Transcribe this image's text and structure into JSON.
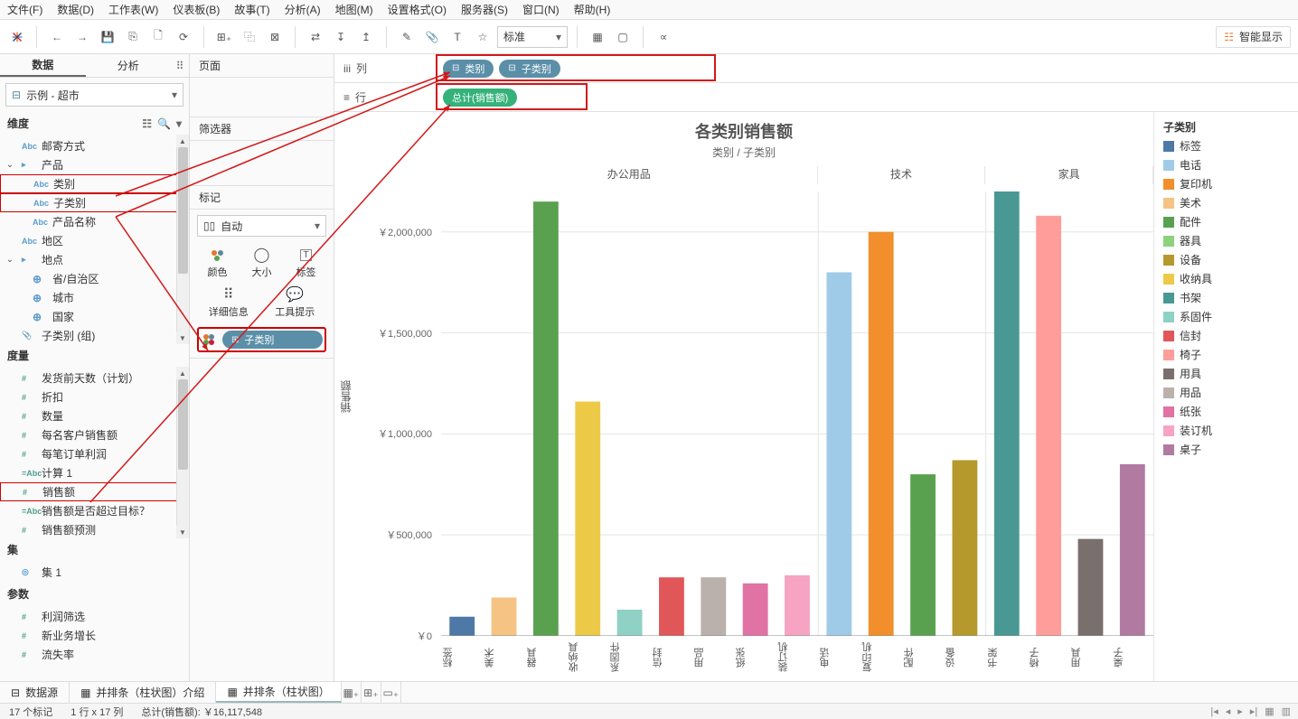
{
  "menu": [
    "文件(F)",
    "数据(D)",
    "工作表(W)",
    "仪表板(B)",
    "故事(T)",
    "分析(A)",
    "地图(M)",
    "设置格式(O)",
    "服务器(S)",
    "窗口(N)",
    "帮助(H)"
  ],
  "toolbar": {
    "style_label": "标准",
    "show_me": "智能显示"
  },
  "left": {
    "tabs": [
      "数据",
      "分析"
    ],
    "datasource": "示例 - 超市",
    "dimensions_title": "维度",
    "measures_title": "度量",
    "sets_title": "集",
    "params_title": "参数",
    "dims": [
      {
        "icon": "Abc",
        "label": "邮寄方式"
      },
      {
        "icon": "folder",
        "label": "产品",
        "expand": true
      },
      {
        "icon": "Abc",
        "label": "类别",
        "indent": 1,
        "hl": true
      },
      {
        "icon": "Abc",
        "label": "子类别",
        "indent": 1,
        "hl": true
      },
      {
        "icon": "Abc",
        "label": "产品名称",
        "indent": 1
      },
      {
        "icon": "Abc",
        "label": "地区"
      },
      {
        "icon": "folder",
        "label": "地点",
        "expand": true
      },
      {
        "icon": "globe",
        "label": "省/自治区",
        "indent": 1
      },
      {
        "icon": "globe",
        "label": "城市",
        "indent": 1
      },
      {
        "icon": "globe",
        "label": "国家",
        "indent": 1
      },
      {
        "icon": "clip",
        "label": "子类别 (组)"
      }
    ],
    "meas": [
      {
        "icon": "#",
        "label": "发货前天数（计划）"
      },
      {
        "icon": "#",
        "label": "折扣"
      },
      {
        "icon": "#",
        "label": "数量"
      },
      {
        "icon": "#",
        "label": "每名客户销售额"
      },
      {
        "icon": "#",
        "label": "每笔订单利润"
      },
      {
        "icon": "=Abc",
        "label": "计算 1"
      },
      {
        "icon": "#",
        "label": "销售额",
        "hl": true
      },
      {
        "icon": "=Abc",
        "label": "销售额是否超过目标？"
      },
      {
        "icon": "#",
        "label": "销售额预测"
      }
    ],
    "sets": [
      {
        "icon": "set",
        "label": "集 1"
      }
    ],
    "params": [
      {
        "icon": "#",
        "label": "利润筛选"
      },
      {
        "icon": "#",
        "label": "新业务增长"
      },
      {
        "icon": "#",
        "label": "流失率"
      }
    ]
  },
  "mid": {
    "pages": "页面",
    "filters": "筛选器",
    "marks": "标记",
    "mark_type": "自动",
    "cells": [
      "颜色",
      "大小",
      "标签",
      "详细信息",
      "工具提示"
    ],
    "color_pill": "子类别"
  },
  "shelves": {
    "columns": "列",
    "rows": "行",
    "col_pills": [
      "类别",
      "子类别"
    ],
    "row_pills": [
      "总计(销售额)"
    ]
  },
  "chart_data": {
    "type": "bar",
    "title": "各类别销售额",
    "subtitle": "类别 / 子类别",
    "ylabel": "销售额",
    "ylim": [
      0,
      2200000
    ],
    "y_ticks": [
      0,
      500000,
      1000000,
      1500000,
      2000000
    ],
    "y_tick_labels": [
      "￥0",
      "￥500,000",
      "￥1,000,000",
      "￥1,500,000",
      "￥2,000,000"
    ],
    "groups": [
      {
        "name": "办公用品",
        "items": [
          {
            "name": "标签",
            "value": 95000,
            "color": "#4e79a7"
          },
          {
            "name": "美术",
            "value": 190000,
            "color": "#f5c383"
          },
          {
            "name": "器具",
            "value": 2150000,
            "color": "#59a14f"
          },
          {
            "name": "收纳具",
            "value": 1160000,
            "color": "#edc948"
          },
          {
            "name": "系固件",
            "value": 130000,
            "color": "#8fd1c5"
          },
          {
            "name": "信封",
            "value": 290000,
            "color": "#e15759"
          },
          {
            "name": "用品",
            "value": 290000,
            "color": "#bab0ac"
          },
          {
            "name": "纸张",
            "value": 260000,
            "color": "#e072a4"
          },
          {
            "name": "装订机",
            "value": 300000,
            "color": "#f6a4c1"
          }
        ]
      },
      {
        "name": "技术",
        "items": [
          {
            "name": "电话",
            "value": 1800000,
            "color": "#a0cbe8"
          },
          {
            "name": "复印机",
            "value": 2000000,
            "color": "#f28e2b"
          },
          {
            "name": "配件",
            "value": 800000,
            "color": "#59a14f"
          },
          {
            "name": "设备",
            "value": 870000,
            "color": "#b6992d"
          }
        ]
      },
      {
        "name": "家具",
        "items": [
          {
            "name": "书架",
            "value": 2250000,
            "color": "#499894"
          },
          {
            "name": "椅子",
            "value": 2080000,
            "color": "#ff9d9a"
          },
          {
            "name": "用具",
            "value": 480000,
            "color": "#79706e"
          },
          {
            "name": "桌子",
            "value": 850000,
            "color": "#b07aa1"
          }
        ]
      }
    ],
    "legend_title": "子类别",
    "legend": [
      {
        "label": "标签",
        "color": "#4e79a7"
      },
      {
        "label": "电话",
        "color": "#a0cbe8"
      },
      {
        "label": "复印机",
        "color": "#f28e2b"
      },
      {
        "label": "美术",
        "color": "#f5c383"
      },
      {
        "label": "配件",
        "color": "#59a14f"
      },
      {
        "label": "器具",
        "color": "#8cd17d"
      },
      {
        "label": "设备",
        "color": "#b6992d"
      },
      {
        "label": "收纳具",
        "color": "#edc948"
      },
      {
        "label": "书架",
        "color": "#499894"
      },
      {
        "label": "系固件",
        "color": "#8fd1c5"
      },
      {
        "label": "信封",
        "color": "#e15759"
      },
      {
        "label": "椅子",
        "color": "#ff9d9a"
      },
      {
        "label": "用具",
        "color": "#79706e"
      },
      {
        "label": "用品",
        "color": "#bab0ac"
      },
      {
        "label": "纸张",
        "color": "#e072a4"
      },
      {
        "label": "装订机",
        "color": "#f6a4c1"
      },
      {
        "label": "桌子",
        "color": "#b07aa1"
      }
    ]
  },
  "bottom": {
    "tabs": [
      {
        "label": "数据源",
        "icon": "db"
      },
      {
        "label": "并排条（柱状图）介绍",
        "icon": "ws"
      },
      {
        "label": "并排条（柱状图）",
        "icon": "ws",
        "active": true
      }
    ]
  },
  "status": {
    "marks": "17 个标记",
    "rc": "1 行 x 17 列",
    "sum": "总计(销售额): ￥16,117,548"
  }
}
